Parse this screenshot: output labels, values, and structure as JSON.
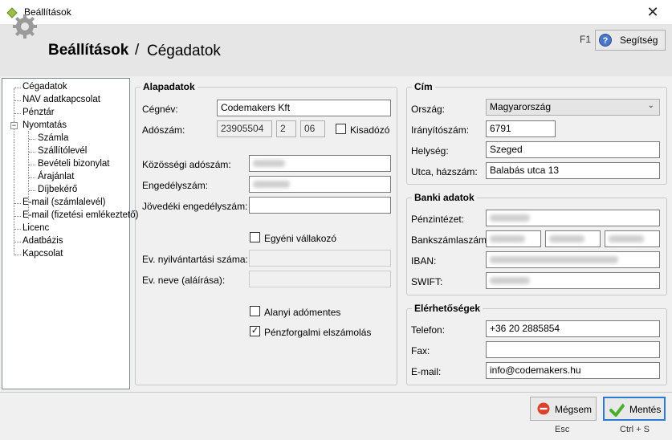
{
  "window": {
    "title": "Beállítások",
    "close_glyph": "✕"
  },
  "header": {
    "title": "Beállítások",
    "separator": "/",
    "subtitle": "Cégadatok",
    "help_key": "F1",
    "help_label": "Segítség",
    "help_icon": "question-icon"
  },
  "tree": {
    "items": [
      {
        "label": "Cégadatok"
      },
      {
        "label": "NAV adatkapcsolat"
      },
      {
        "label": "Pénztár"
      },
      {
        "label": "Nyomtatás"
      },
      {
        "label": "Számla"
      },
      {
        "label": "Szállítólevél"
      },
      {
        "label": "Bevételi bizonylat"
      },
      {
        "label": "Árajánlat"
      },
      {
        "label": "Díjbekérő"
      },
      {
        "label": "E-mail (számlalevél)"
      },
      {
        "label": "E-mail (fizetési emlékeztető)"
      },
      {
        "label": "Licenc"
      },
      {
        "label": "Adatbázis"
      },
      {
        "label": "Kapcsolat"
      }
    ],
    "collapse_glyph": "−"
  },
  "basic": {
    "title": "Alapadatok",
    "company_label": "Cégnév:",
    "company_value": "Codemakers Kft",
    "tax_label": "Adószám:",
    "tax_1": "23905504",
    "tax_2": "2",
    "tax_3": "06",
    "kisadozo_label": "Kisadózó",
    "community_tax_label": "Közösségi adószám:",
    "permit_label": "Engedélyszám:",
    "excise_label": "Jövedéki engedélyszám:",
    "sole_trader_label": "Egyéni vállakozó",
    "reg_number_label": "Ev. nyilvántartási száma:",
    "signature_label": "Ev. neve (aláírása):",
    "vat_exempt_label": "Alanyi adómentes",
    "cash_accounting_label": "Pénzforgalmi elszámolás",
    "cash_accounting_check": "✓"
  },
  "address": {
    "title": "Cím",
    "country_label": "Ország:",
    "country_value": "Magyarország",
    "zip_label": "Irányítószám:",
    "zip_value": "6791",
    "city_label": "Helység:",
    "city_value": "Szeged",
    "street_label": "Utca, házszám:",
    "street_value": "Balabás utca 13"
  },
  "bank": {
    "title": "Banki adatok",
    "bank_label": "Pénzintézet:",
    "account_label": "Bankszámlaszám:",
    "iban_label": "IBAN:",
    "swift_label": "SWIFT:"
  },
  "contact": {
    "title": "Elérhetőségek",
    "phone_label": "Telefon:",
    "phone_value": "+36 20 2885854",
    "fax_label": "Fax:",
    "email_label": "E-mail:",
    "email_value": "info@codemakers.hu"
  },
  "footer": {
    "cancel_label": "Mégsem",
    "cancel_hint": "Esc",
    "save_label": "Mentés",
    "save_hint": "Ctrl + S"
  },
  "colors": {
    "accent": "#2b7bd6",
    "cancel": "#d9432b",
    "save": "#4cae2f"
  }
}
